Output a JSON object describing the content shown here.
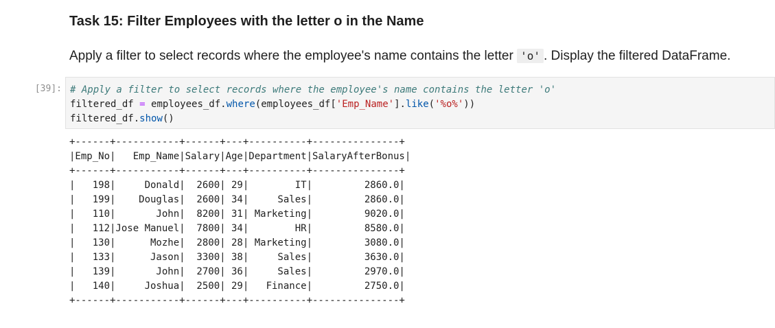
{
  "markdown": {
    "title": "Task 15: Filter Employees with the letter o in the Name",
    "para_before": "Apply a filter to select records where the employee's name contains the letter ",
    "para_code": "'o'",
    "para_after": ". Display the filtered DataFrame."
  },
  "cell": {
    "prompt": "[39]:",
    "line1_comment": "# Apply a filter to select records where the employee's name contains the letter 'o'",
    "line2_a": "filtered_df ",
    "line2_op": "=",
    "line2_b": " employees_df",
    "line2_dot1": ".",
    "line2_where": "where",
    "line2_c": "(employees_df[",
    "line2_str1": "'Emp_Name'",
    "line2_d": "]",
    "line2_dot2": ".",
    "line2_like": "like",
    "line2_e": "(",
    "line2_str2": "'%o%'",
    "line2_f": "))",
    "line3_a": "filtered_df",
    "line3_dot": ".",
    "line3_show": "show",
    "line3_b": "()"
  },
  "output": {
    "border": "+------+-----------+------+---+----------+---------------+",
    "header": "|Emp_No|   Emp_Name|Salary|Age|Department|SalaryAfterBonus|",
    "rows": [
      "|   198|     Donald|  2600| 29|        IT|         2860.0|",
      "|   199|    Douglas|  2600| 34|     Sales|         2860.0|",
      "|   110|       John|  8200| 31| Marketing|         9020.0|",
      "|   112|Jose Manuel|  7800| 34|        HR|         8580.0|",
      "|   130|      Mozhe|  2800| 28| Marketing|         3080.0|",
      "|   133|      Jason|  3300| 38|     Sales|         3630.0|",
      "|   139|       John|  2700| 36|     Sales|         2970.0|",
      "|   140|     Joshua|  2500| 29|   Finance|         2750.0|"
    ]
  }
}
